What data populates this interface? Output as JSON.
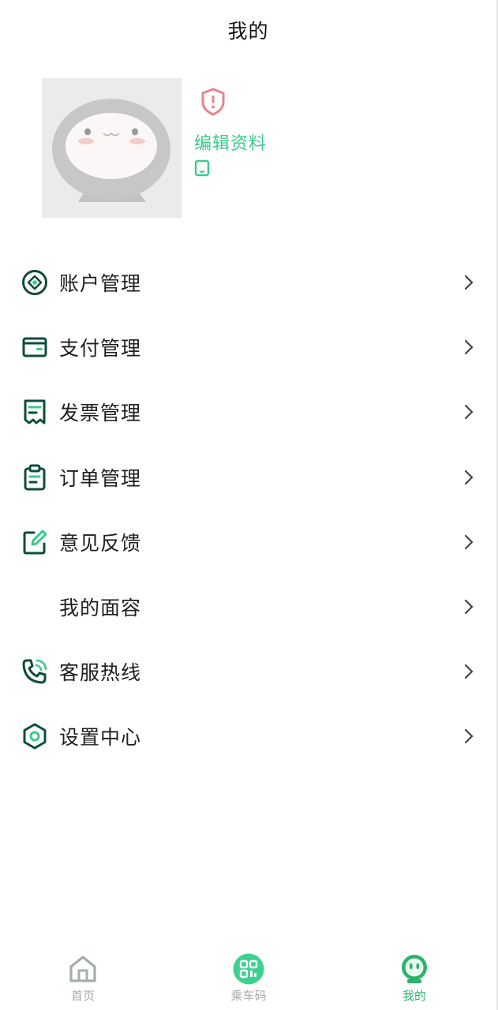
{
  "header": {
    "title": "我的"
  },
  "profile": {
    "edit_label": "编辑资料"
  },
  "menu": [
    {
      "label": "账户管理",
      "icon": "account-icon"
    },
    {
      "label": "支付管理",
      "icon": "wallet-icon"
    },
    {
      "label": "发票管理",
      "icon": "invoice-icon"
    },
    {
      "label": "订单管理",
      "icon": "clipboard-icon"
    },
    {
      "label": "意见反馈",
      "icon": "edit-icon"
    },
    {
      "label": "我的面容",
      "icon": ""
    },
    {
      "label": "客服热线",
      "icon": "phone-call-icon"
    },
    {
      "label": "设置中心",
      "icon": "settings-hexagon-icon"
    }
  ],
  "tabbar": [
    {
      "label": "首页",
      "icon": "home-icon",
      "active": false
    },
    {
      "label": "乘车码",
      "icon": "qr-code-icon",
      "active": false
    },
    {
      "label": "我的",
      "icon": "profile-robot-icon",
      "active": true
    }
  ],
  "colors": {
    "accent": "#3dc98a",
    "icon_dark": "#0e4d3a",
    "warning": "#e8838e",
    "tab_inactive": "#a9a9a9"
  }
}
